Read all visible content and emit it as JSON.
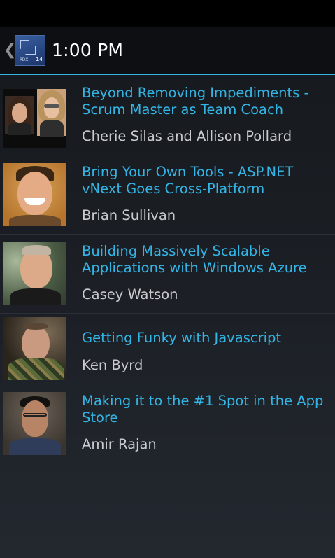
{
  "action_bar": {
    "title": "1:00 PM",
    "app_icon": {
      "name": "conference-logo-icon",
      "subtitle": "PDX",
      "year": "14"
    },
    "up_icon": "chevron-left-icon"
  },
  "sessions": [
    {
      "title": "Beyond Removing Impediments - Scrum Master as Team Coach",
      "speaker": "Cherie Silas and Allison Pollard"
    },
    {
      "title": "Bring Your Own Tools - ASP.NET vNext Goes Cross-Platform",
      "speaker": "Brian Sullivan"
    },
    {
      "title": "Building Massively Scalable Applications with Windows Azure",
      "speaker": "Casey Watson"
    },
    {
      "title": "Getting Funky with Javascript",
      "speaker": "Ken Byrd"
    },
    {
      "title": "Making it to the #1 Spot in the App Store",
      "speaker": "Amir Rajan"
    }
  ],
  "colors": {
    "accent": "#33b5e5",
    "speaker_text": "#c9cbce",
    "divider": "#2b3036"
  }
}
